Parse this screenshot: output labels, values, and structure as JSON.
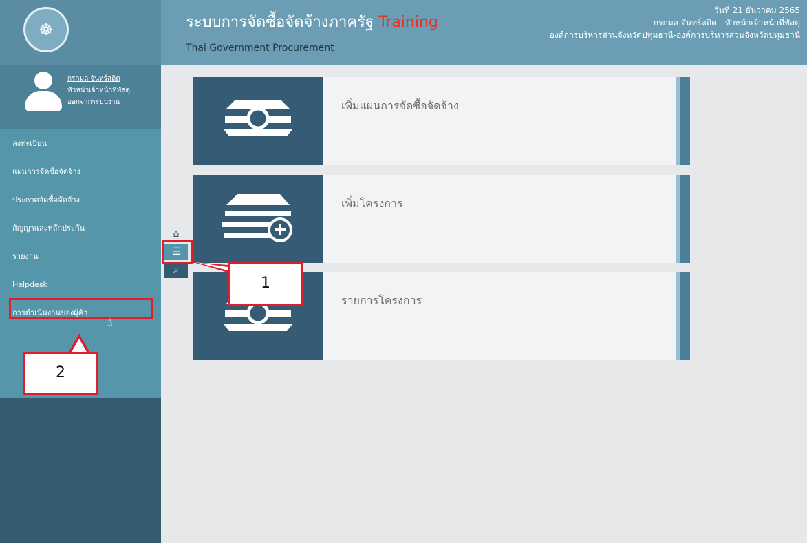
{
  "header": {
    "title": "ระบบการจัดซื้อจัดจ้างภาครัฐ",
    "title_accent": "Training",
    "subtitle": "Thai Government Procurement",
    "date": "วันที่ 21 ธันวาคม 2565",
    "user_line": "กรกมล จันทร์สถิต - หัวหน้าเจ้าหน้าที่พัสดุ",
    "org_line": "องค์การบริหารส่วนจังหวัดปทุมธานี-องค์การบริหารส่วนจังหวัดปทุมธานี"
  },
  "user": {
    "name": "กรกมล จันทร์สถิต",
    "role": "หัวหน้าเจ้าหน้าที่พัสดุ",
    "logout": "ออกจากระบบงาน"
  },
  "sidebar": {
    "items": [
      {
        "label": "ลงทะเบียน"
      },
      {
        "label": "แผนการจัดซื้อจัดจ้าง"
      },
      {
        "label": "ประกาศจัดซื้อจัดจ้าง"
      },
      {
        "label": "สัญญาและหลักประกัน"
      },
      {
        "label": "รายงาน"
      },
      {
        "label": "Helpdesk"
      },
      {
        "label": "การดำเนินงานของผู้ค้า"
      }
    ]
  },
  "cards": [
    {
      "label": "เพิ่มแผนการจัดซื้อจัดจ้าง"
    },
    {
      "label": "เพิ่มโครงการ"
    },
    {
      "label": "รายการโครงการ"
    }
  ],
  "callouts": {
    "one": "1",
    "two": "2"
  },
  "colors": {
    "sidebar": "#345b72",
    "header": "#6b9eb4",
    "highlight": "#e11d2a",
    "accent": "#e5332a"
  }
}
